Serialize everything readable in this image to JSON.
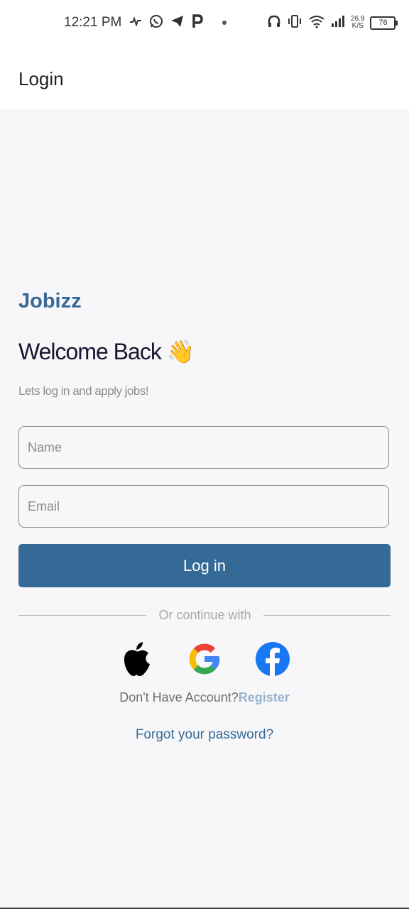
{
  "status_bar": {
    "time": "12:21 PM",
    "net_speed_value": "26.9",
    "net_speed_unit": "K/S",
    "battery": "76",
    "left_icons": [
      "activity-icon",
      "whatsapp-icon",
      "telegram-icon",
      "p-app-icon",
      "dot-icon"
    ],
    "right_icons": [
      "headphones-icon",
      "vibrate-icon",
      "wifi-icon",
      "signal-icon"
    ]
  },
  "app_bar": {
    "title": "Login"
  },
  "brand": "Jobizz",
  "welcome": {
    "text": "Welcome Back",
    "emoji": "👋"
  },
  "subtitle": "Lets log in and apply jobs!",
  "form": {
    "name_placeholder": "Name",
    "name_value": "",
    "email_placeholder": "Email",
    "email_value": "",
    "login_label": "Log in"
  },
  "divider_text": "Or continue with",
  "social": [
    "apple-icon",
    "google-icon",
    "facebook-icon"
  ],
  "register": {
    "prompt": "Don't Have Account?",
    "link": "Register"
  },
  "forgot": "Forgot your password?",
  "colors": {
    "primary": "#356a97",
    "register_link": "#9ab4cd",
    "background": "#f7f7f9"
  }
}
